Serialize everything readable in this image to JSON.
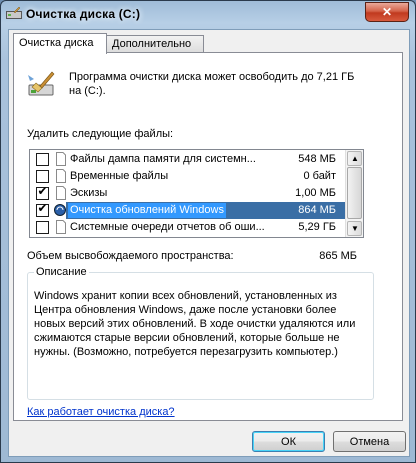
{
  "window": {
    "title": "Очистка диска  (C:)",
    "close_label": "✕"
  },
  "tabs": [
    {
      "label": "Очистка диска"
    },
    {
      "label": "Дополнительно"
    }
  ],
  "intro": {
    "line1": "Программа очистки диска может освободить до 7,21 ГБ",
    "line2": "на  (C:)."
  },
  "files_label": "Удалить следующие файлы:",
  "files": [
    {
      "name": "Файлы дампа памяти для системн...",
      "size": "548 МБ",
      "checked": false
    },
    {
      "name": "Временные файлы",
      "size": "0 байт",
      "checked": false
    },
    {
      "name": "Эскизы",
      "size": "1,00 МБ",
      "checked": true
    },
    {
      "name": "Очистка обновлений Windows",
      "size": "864 МБ",
      "checked": true,
      "selected": true
    },
    {
      "name": "Системные очереди отчетов об оши...",
      "size": "5,29 ГБ",
      "checked": false
    }
  ],
  "space": {
    "label": "Объем высвобождаемого пространства:",
    "value": "865 МБ"
  },
  "description": {
    "legend": "Описание",
    "text": "Windows хранит копии всех обновлений, установленных из Центра обновления Windows, даже после установки более новых версий этих обновлений. В ходе очистки удаляются или сжимаются старые версии обновлений, которые больше не нужны. (Возможно, потребуется перезагрузить компьютер.)"
  },
  "help_link": "Как работает очистка диска?",
  "buttons": {
    "ok": "ОК",
    "cancel": "Отмена"
  },
  "scrollbar": {
    "up_glyph": "▲",
    "down_glyph": "▼"
  },
  "colors": {
    "selection": "#3399ff",
    "link": "#0033cc",
    "close": "#c03a1f"
  }
}
